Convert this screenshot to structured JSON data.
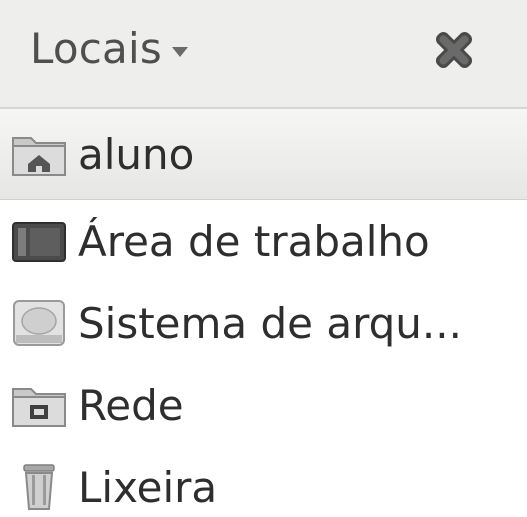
{
  "header": {
    "title": "Locais",
    "dropdown_icon": "chevron-down-icon",
    "close_icon": "close-icon"
  },
  "places": [
    {
      "label": "aluno",
      "icon": "home-folder-icon",
      "selected": true
    },
    {
      "label": "Área de trabalho",
      "icon": "desktop-icon",
      "selected": false
    },
    {
      "label": "Sistema de arqu...",
      "icon": "hard-drive-icon",
      "selected": false
    },
    {
      "label": "Rede",
      "icon": "network-folder-icon",
      "selected": false
    },
    {
      "label": "Lixeira",
      "icon": "trash-icon",
      "selected": false
    }
  ],
  "colors": {
    "header_bg": "#eeeeec",
    "selected_bg": "#e9e9e7",
    "text": "#2e2e2e"
  }
}
